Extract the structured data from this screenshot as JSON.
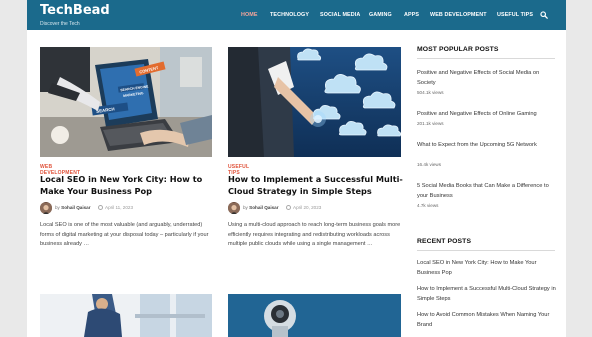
{
  "site": {
    "title": "TechBead",
    "tagline": "Discover the Tech"
  },
  "nav": [
    {
      "label": "HOME",
      "active": true
    },
    {
      "label": "TECHNOLOGY"
    },
    {
      "label": "SOCIAL MEDIA"
    },
    {
      "label": "GAMING"
    },
    {
      "label": "APPS"
    },
    {
      "label": "WEB DEVELOPMENT"
    },
    {
      "label": "USEFUL TIPS"
    }
  ],
  "posts": [
    {
      "category": "WEB DEVELOPMENT",
      "title": "Local SEO in New York City: How to Make Your Business Pop",
      "by": "by",
      "author": "Sohail Qaisar",
      "date": "April 11, 2023",
      "excerpt": "Local SEO is one of the most valuable (and arguably, underrated) forms of digital marketing at your disposal today – particularly if your business already …",
      "thumb_labels": [
        "SEARCH ENGINE",
        "MARKETING",
        "CONTENT",
        "SEARCH"
      ]
    },
    {
      "category": "USEFUL TIPS",
      "title": "How to Implement a Successful Multi-Cloud Strategy in Simple Steps",
      "by": "by",
      "author": "Sohail Qaisar",
      "date": "April 20, 2023",
      "excerpt": "Using a multi-cloud approach to reach long-term business goals more efficiently requires integrating and redistributing workloads across multiple public clouds while using a single management …"
    }
  ],
  "sidebar": {
    "popular_heading": "MOST POPULAR POSTS",
    "popular": [
      {
        "title": "Positive and Negative Effects of Social Media on Society",
        "views": "504.1k views"
      },
      {
        "title": "Positive and Negative Effects of Online Gaming",
        "views": "201.1k views"
      },
      {
        "title": "What to Expect from the Upcoming 5G Network",
        "views": "16.4k views"
      },
      {
        "title": "5 Social Media Books that Can Make a Difference to your Business",
        "views": "4.7k views"
      }
    ],
    "recent_heading": "RECENT POSTS",
    "recent": [
      {
        "title": "Local SEO in New York City: How to Make Your Business Pop"
      },
      {
        "title": "How to Implement a Successful Multi-Cloud Strategy in Simple Steps"
      },
      {
        "title": "How to Avoid Common Mistakes When Naming Your Brand"
      }
    ]
  },
  "colors": {
    "header": "#1b6a8c",
    "accent": "#e0533b",
    "active_nav": "#f4a49a"
  }
}
